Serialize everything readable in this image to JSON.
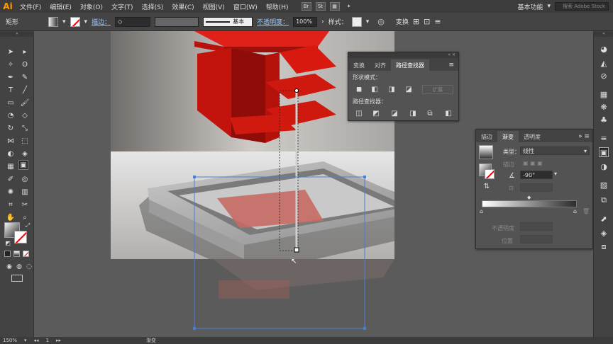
{
  "app": {
    "logo": "Ai",
    "workspace": "基本功能",
    "search_placeholder": "搜索 Adobe Stock"
  },
  "menus": [
    "文件(F)",
    "编辑(E)",
    "对象(O)",
    "文字(T)",
    "选择(S)",
    "效果(C)",
    "视图(V)",
    "窗口(W)",
    "帮助(H)"
  ],
  "app_icons": [
    "Br",
    "St"
  ],
  "control_bar": {
    "object_type": "矩形",
    "stroke_label": "描边：",
    "stroke_profile": "基本",
    "opacity_label": "不透明度：",
    "opacity_value": "100%",
    "style_label": "样式：",
    "transform_label": "变换"
  },
  "pathfinder_panel": {
    "tabs": [
      "变换",
      "对齐",
      "路径查找器"
    ],
    "active_tab": "路径查找器",
    "shape_modes_label": "形状模式：",
    "expand_label": "扩展",
    "pathfinders_label": "路径查找器："
  },
  "gradient_panel": {
    "tabs": [
      "描边",
      "渐变",
      "透明度"
    ],
    "active_tab": "渐变",
    "type_label": "类型：",
    "type_value": "线性",
    "stroke_label": "描边",
    "angle_value": "-90°",
    "opacity_label": "不透明度",
    "position_label": "位置"
  },
  "status_bar": {
    "zoom": "150%",
    "page": "1",
    "tool": "渐变"
  },
  "colors": {
    "accent": "#ff9a00",
    "red_object": "#d8190f",
    "selection": "#4a7fd4"
  }
}
